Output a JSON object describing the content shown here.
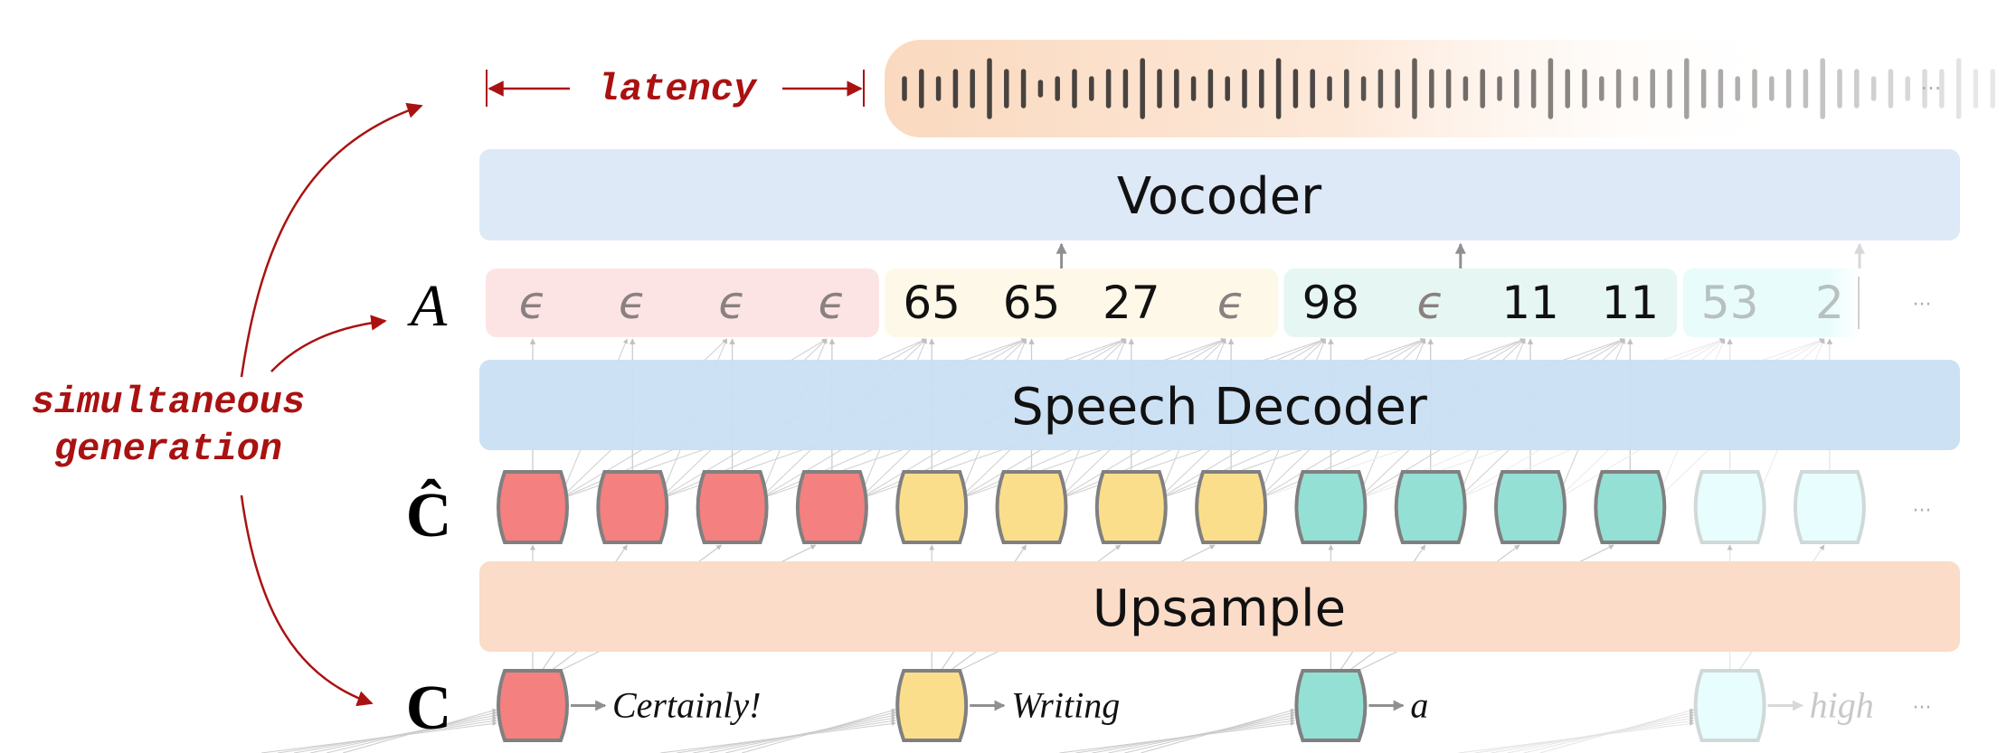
{
  "diagram": {
    "annotations": {
      "latency": "latency",
      "simultaneous_line1": "simultaneous",
      "simultaneous_line2": "generation"
    },
    "row_labels": {
      "audio_tokens": "A",
      "upsampled": "Ĉ",
      "text_tokens": "C"
    },
    "layers": {
      "vocoder": "Vocoder",
      "speech_decoder": "Speech Decoder",
      "upsample": "Upsample"
    },
    "ellipsis": "···",
    "colors": {
      "annotation_red": "#aa1111",
      "vocoder_bg": "#dde9f6",
      "decoder_bg": "#c9dff3",
      "upsample_bg": "#fadcc8",
      "block_border": "#808080",
      "connector": "#c0c0c0",
      "epsilon": "#8a8080"
    },
    "groups": [
      {
        "word": "Certainly!",
        "block_color": "#f48080",
        "group_bg": "#fde4e4",
        "faded": false,
        "tokens": [
          "ϵ",
          "ϵ",
          "ϵ",
          "ϵ"
        ]
      },
      {
        "word": "Writing",
        "block_color": "#fbde8c",
        "group_bg": "#fef8e8",
        "faded": false,
        "tokens": [
          "65",
          "65",
          "27",
          "ϵ"
        ]
      },
      {
        "word": "a",
        "block_color": "#94e0d4",
        "group_bg": "#e6f7f3",
        "faded": false,
        "tokens": [
          "98",
          "ϵ",
          "11",
          "11"
        ]
      },
      {
        "word": "high",
        "block_color": "#e8fdfd",
        "group_bg": "#e8fcfc",
        "faded": true,
        "tokens": [
          "53",
          "2"
        ]
      }
    ],
    "waveform": {
      "bar_levels": [
        1,
        2,
        1,
        2,
        2,
        3,
        2,
        2,
        0,
        1,
        2,
        1,
        2,
        2,
        3,
        2,
        2,
        1,
        2,
        1,
        2,
        2,
        3,
        2,
        2,
        1,
        2,
        1,
        2,
        2,
        3,
        2,
        2,
        1,
        2,
        1,
        2,
        2,
        3,
        2,
        2,
        1,
        2,
        1,
        2,
        2,
        3,
        2,
        2,
        1,
        2,
        1,
        2,
        2,
        3,
        2,
        2,
        1,
        2,
        1,
        2,
        2,
        3,
        2,
        2
      ],
      "fade_start_fraction": 0.35
    }
  }
}
